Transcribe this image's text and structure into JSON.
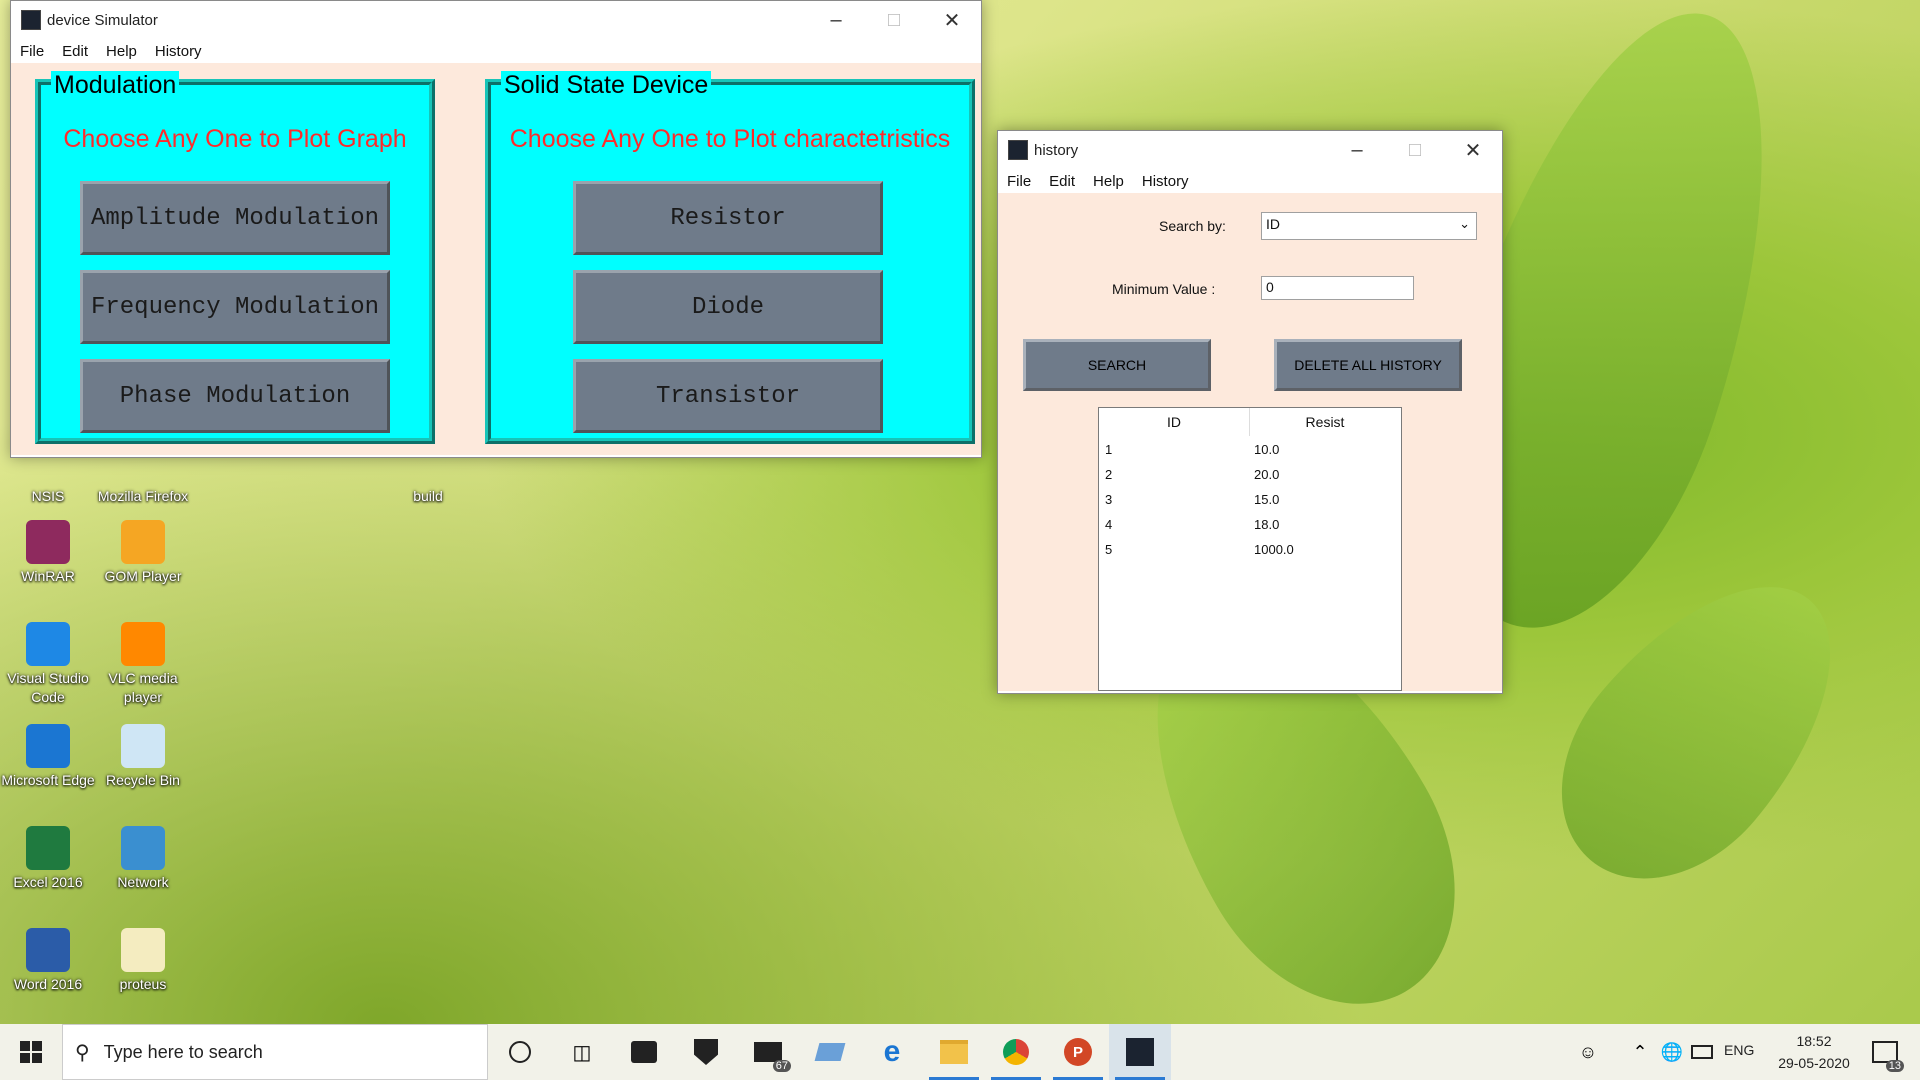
{
  "desktop": {
    "icons": [
      {
        "label": "NSIS",
        "icon": "nsis-icon",
        "color": "#7a3a2a"
      },
      {
        "label": "Mozilla Firefox",
        "icon": "firefox-icon",
        "color": "#e66000"
      },
      {
        "label": "build",
        "icon": "folder-icon",
        "color": "#e8c05a"
      },
      {
        "label": "WinRAR",
        "icon": "winrar-icon",
        "color": "#8e2a5e"
      },
      {
        "label": "GOM Player",
        "icon": "gom-player-icon",
        "color": "#f5a623"
      },
      {
        "label": "Visual Studio Code",
        "icon": "vscode-icon",
        "color": "#1e88e5"
      },
      {
        "label": "VLC media player",
        "icon": "vlc-icon",
        "color": "#ff8800"
      },
      {
        "label": "Microsoft Edge",
        "icon": "edge-icon",
        "color": "#1b76d2"
      },
      {
        "label": "Recycle Bin",
        "icon": "recycle-bin-icon",
        "color": "#cfe6f5"
      },
      {
        "label": "Excel 2016",
        "icon": "excel-icon",
        "color": "#1f7a3f"
      },
      {
        "label": "Network",
        "icon": "network-icon",
        "color": "#3a8fd0"
      },
      {
        "label": "Word 2016",
        "icon": "word-icon",
        "color": "#2b5ca8"
      },
      {
        "label": "proteus",
        "icon": "file-icon",
        "color": "#f4ecc0"
      }
    ]
  },
  "simulator": {
    "title": "device Simulator",
    "menu": [
      "File",
      "Edit",
      "Help",
      "History"
    ],
    "modulation": {
      "heading": "Modulation",
      "subtitle": "Choose Any One to Plot Graph",
      "buttons": [
        "Amplitude Modulation",
        "Frequency Modulation",
        "Phase Modulation"
      ]
    },
    "solid_state": {
      "heading": "Solid State Device",
      "subtitle": "Choose Any One to Plot charactetristics",
      "buttons": [
        "Resistor",
        "Diode",
        "Transistor"
      ]
    }
  },
  "history": {
    "title": "history",
    "menu": [
      "File",
      "Edit",
      "Help",
      "History"
    ],
    "search_by_label": "Search by:",
    "search_by_value": "ID",
    "min_value_label": "Minimum Value :",
    "min_value": "0",
    "search_button": "SEARCH",
    "delete_button": "DELETE ALL HISTORY",
    "table": {
      "columns": [
        "ID",
        "Resist"
      ],
      "rows": [
        [
          "1",
          "10.0"
        ],
        [
          "2",
          "20.0"
        ],
        [
          "3",
          "15.0"
        ],
        [
          "4",
          "18.0"
        ],
        [
          "5",
          "1000.0"
        ]
      ]
    }
  },
  "taskbar": {
    "search_placeholder": "Type here to search",
    "mail_badge": "67",
    "language": "ENG",
    "time": "18:52",
    "date": "29-05-2020",
    "notification_count": "13"
  }
}
